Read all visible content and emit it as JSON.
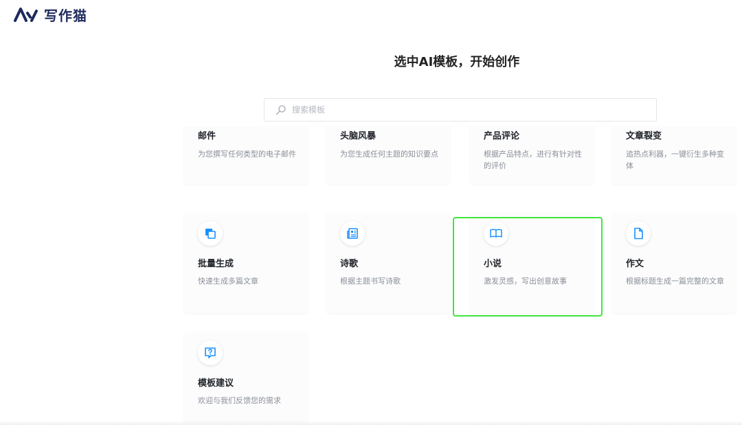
{
  "brand": {
    "name": "写作猫"
  },
  "headline": "选中AI模板，开始创作",
  "search": {
    "placeholder": "搜索模板",
    "value": ""
  },
  "cards_row1": [
    {
      "title": "邮件",
      "desc": "为您撰写任何类型的电子邮件"
    },
    {
      "title": "头脑风暴",
      "desc": "为您生成任何主题的知识要点"
    },
    {
      "title": "产品评论",
      "desc": "根据产品特点，进行有针对性的评价"
    },
    {
      "title": "文章裂变",
      "desc": "追热点利器，一键衍生多种变体"
    }
  ],
  "cards_row2": [
    {
      "title": "批量生成",
      "desc": "快速生成多篇文章",
      "icon": "copy-icon"
    },
    {
      "title": "诗歌",
      "desc": "根据主题书写诗歌",
      "icon": "newspaper-icon"
    },
    {
      "title": "小说",
      "desc": "激发灵感，写出创意故事",
      "icon": "book-icon"
    },
    {
      "title": "作文",
      "desc": "根据标题生成一篇完整的文章",
      "icon": "document-icon"
    }
  ],
  "cards_row3": [
    {
      "title": "模板建议",
      "desc": "欢迎与我们反馈您的需求",
      "icon": "feedback-question-icon"
    }
  ],
  "colors": {
    "accent": "#1890ff",
    "highlight": "#3ee63e",
    "brand": "#1d2a5e"
  }
}
